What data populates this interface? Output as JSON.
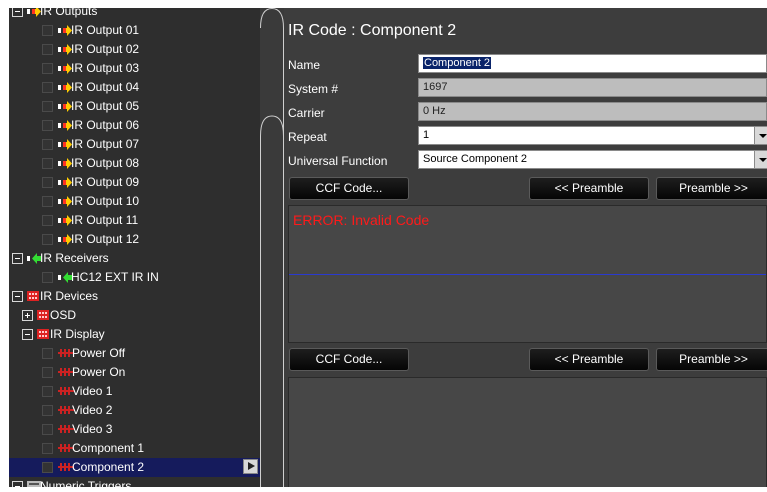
{
  "tree": {
    "rows": [
      {
        "label": "IR Outputs",
        "type": "exp-minus",
        "icon": "ir-output-icon",
        "indent": 0,
        "selected": false
      },
      {
        "label": "IR Output 01",
        "type": "leaf",
        "icon": "ir-output-icon",
        "indent": 1,
        "selected": false
      },
      {
        "label": "IR Output 02",
        "type": "leaf",
        "icon": "ir-output-icon",
        "indent": 1,
        "selected": false
      },
      {
        "label": "IR Output 03",
        "type": "leaf",
        "icon": "ir-output-icon",
        "indent": 1,
        "selected": false
      },
      {
        "label": "IR Output 04",
        "type": "leaf",
        "icon": "ir-output-icon",
        "indent": 1,
        "selected": false
      },
      {
        "label": "IR Output 05",
        "type": "leaf",
        "icon": "ir-output-icon",
        "indent": 1,
        "selected": false
      },
      {
        "label": "IR Output 06",
        "type": "leaf",
        "icon": "ir-output-icon",
        "indent": 1,
        "selected": false
      },
      {
        "label": "IR Output 07",
        "type": "leaf",
        "icon": "ir-output-icon",
        "indent": 1,
        "selected": false
      },
      {
        "label": "IR Output 08",
        "type": "leaf",
        "icon": "ir-output-icon",
        "indent": 1,
        "selected": false
      },
      {
        "label": "IR Output 09",
        "type": "leaf",
        "icon": "ir-output-icon",
        "indent": 1,
        "selected": false
      },
      {
        "label": "IR Output 10",
        "type": "leaf",
        "icon": "ir-output-icon",
        "indent": 1,
        "selected": false
      },
      {
        "label": "IR Output 11",
        "type": "leaf",
        "icon": "ir-output-icon",
        "indent": 1,
        "selected": false
      },
      {
        "label": "IR Output 12",
        "type": "leaf",
        "icon": "ir-output-icon",
        "indent": 1,
        "selected": false
      },
      {
        "label": "IR Receivers",
        "type": "exp-minus",
        "icon": "ir-receiver-icon",
        "indent": 0,
        "selected": false
      },
      {
        "label": "HC12 EXT IR IN",
        "type": "leaf",
        "icon": "ir-receiver-icon",
        "indent": 1,
        "selected": false
      },
      {
        "label": "IR Devices",
        "type": "exp-minus",
        "icon": "ir-device-icon",
        "indent": 0,
        "selected": false
      },
      {
        "label": "OSD",
        "type": "exp-plus",
        "icon": "ir-device-icon",
        "indent": 1,
        "selected": false
      },
      {
        "label": "IR Display",
        "type": "exp-minus",
        "icon": "ir-device-icon",
        "indent": 1,
        "selected": false
      },
      {
        "label": "Power Off",
        "type": "leaf",
        "icon": "ir-code-icon",
        "indent": 2,
        "selected": false
      },
      {
        "label": "Power On",
        "type": "leaf",
        "icon": "ir-code-icon",
        "indent": 2,
        "selected": false
      },
      {
        "label": "Video 1",
        "type": "leaf",
        "icon": "ir-code-icon",
        "indent": 2,
        "selected": false
      },
      {
        "label": "Video 2",
        "type": "leaf",
        "icon": "ir-code-icon",
        "indent": 2,
        "selected": false
      },
      {
        "label": "Video 3",
        "type": "leaf",
        "icon": "ir-code-icon",
        "indent": 2,
        "selected": false
      },
      {
        "label": "Component 1",
        "type": "leaf",
        "icon": "ir-code-icon",
        "indent": 2,
        "selected": false
      },
      {
        "label": "Component 2",
        "type": "leaf",
        "icon": "ir-code-icon",
        "indent": 2,
        "selected": true
      },
      {
        "label": "Numeric Triggers",
        "type": "exp-minus",
        "icon": "trigger-icon",
        "indent": 0,
        "selected": false
      }
    ]
  },
  "panel": {
    "title": "IR Code : Component 2",
    "fields": {
      "name_label": "Name",
      "name_value": "Component 2",
      "system_label": "System #",
      "system_value": "1697",
      "carrier_label": "Carrier",
      "carrier_value": "0 Hz",
      "repeat_label": "Repeat",
      "repeat_value": "1",
      "universal_label": "Universal Function",
      "universal_value": "Source Component 2"
    },
    "buttons": {
      "ccf": "CCF Code...",
      "prev_preamble": "<< Preamble",
      "next_preamble": "Preamble >>"
    },
    "error": "ERROR: Invalid Code"
  },
  "colors": {
    "tree_bg": "#2e2e2e",
    "panel_bg": "#3d3d3d",
    "selection": "#151b5c",
    "error": "#ff1a1a",
    "ir_output": "#ffcc00",
    "ir_receiver": "#33dd33",
    "ir_device": "#dd2222"
  }
}
